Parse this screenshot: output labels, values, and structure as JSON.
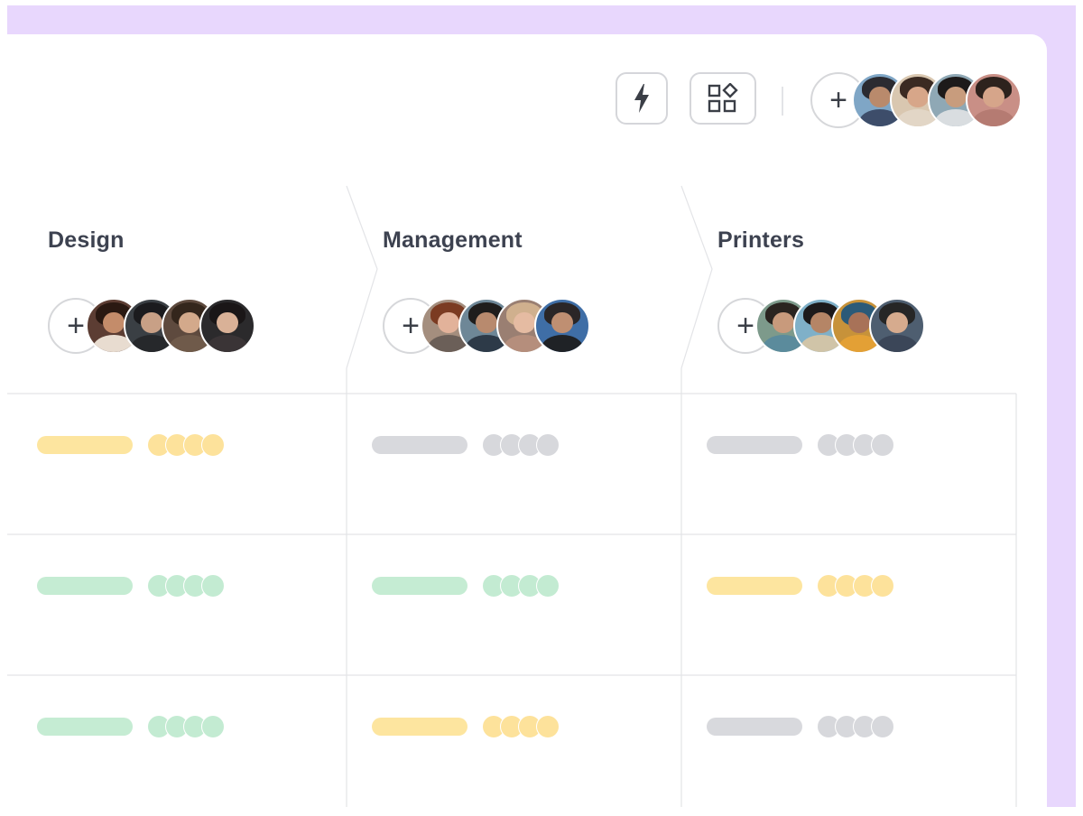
{
  "toolbar": {
    "automation_icon": "lightning-icon",
    "apps_icon": "apps-shapes-icon",
    "add_member_label": "+",
    "member_avatars": [
      {
        "bg": "#7fa6c6",
        "hair": "#2b2b31",
        "face": "#b98a6c",
        "body": "#3d4d6a"
      },
      {
        "bg": "#d9c7b0",
        "hair": "#3b2a22",
        "face": "#d7a689",
        "body": "#e2d6c6"
      },
      {
        "bg": "#8fa8b5",
        "hair": "#1d1a1a",
        "face": "#c89c7d",
        "body": "#d9dde0"
      },
      {
        "bg": "#c98f86",
        "hair": "#2d221d",
        "face": "#d6a58a",
        "body": "#b57b72"
      }
    ]
  },
  "columns": [
    {
      "title": "Design",
      "add_label": "+",
      "avatars": [
        {
          "bg": "#5c3d33",
          "hair": "#2a1912",
          "face": "#c48c6a",
          "body": "#e8dcd0"
        },
        {
          "bg": "#3a3f44",
          "hair": "#1b1b1e",
          "face": "#c8a086",
          "body": "#26282b"
        },
        {
          "bg": "#5e4a3e",
          "hair": "#34261c",
          "face": "#d3a98b",
          "body": "#6f5a4a"
        },
        {
          "bg": "#2b2a2c",
          "hair": "#1a1617",
          "face": "#d9b197",
          "body": "#3a3436"
        }
      ],
      "rows": [
        {
          "status": "yellow"
        },
        {
          "status": "green"
        },
        {
          "status": "green"
        }
      ]
    },
    {
      "title": "Management",
      "add_label": "+",
      "avatars": [
        {
          "bg": "#a48e7e",
          "hair": "#7b3b22",
          "face": "#e2b29a",
          "body": "#6b5f58"
        },
        {
          "bg": "#6e8797",
          "hair": "#1f1d1c",
          "face": "#b88a6e",
          "body": "#2d3a48"
        },
        {
          "bg": "#9a7f72",
          "hair": "#d0b08e",
          "face": "#e5bba2",
          "body": "#b58e7c"
        },
        {
          "bg": "#3f6ea6",
          "hair": "#2a2627",
          "face": "#bf8f72",
          "body": "#1f2226"
        }
      ],
      "rows": [
        {
          "status": "grey"
        },
        {
          "status": "green"
        },
        {
          "status": "yellow"
        }
      ]
    },
    {
      "title": "Printers",
      "add_label": "+",
      "avatars": [
        {
          "bg": "#7d9a8b",
          "hair": "#2a2420",
          "face": "#c89a7c",
          "body": "#5b8b9c"
        },
        {
          "bg": "#7fb0c8",
          "hair": "#1c1a1b",
          "face": "#b58566",
          "body": "#d0c4a8"
        },
        {
          "bg": "#c7923a",
          "hair": "#2b5a78",
          "face": "#a87258",
          "body": "#e3a035"
        },
        {
          "bg": "#4e5e70",
          "hair": "#262626",
          "face": "#d6ab8e",
          "body": "#3b4658"
        }
      ],
      "rows": [
        {
          "status": "grey"
        },
        {
          "status": "yellow"
        },
        {
          "status": "grey"
        }
      ]
    }
  ],
  "status_colors": {
    "yellow": {
      "pill": "#fde59f",
      "dot": "#fde29b"
    },
    "green": {
      "pill": "#c5ecd3",
      "dot": "#c3ebd2"
    },
    "grey": {
      "pill": "#d8d9dd",
      "dot": "#d7d8dc"
    }
  },
  "theme": {
    "accent_bg": "#e8d7fd",
    "text": "#3d4250",
    "border": "#d5d6da"
  }
}
